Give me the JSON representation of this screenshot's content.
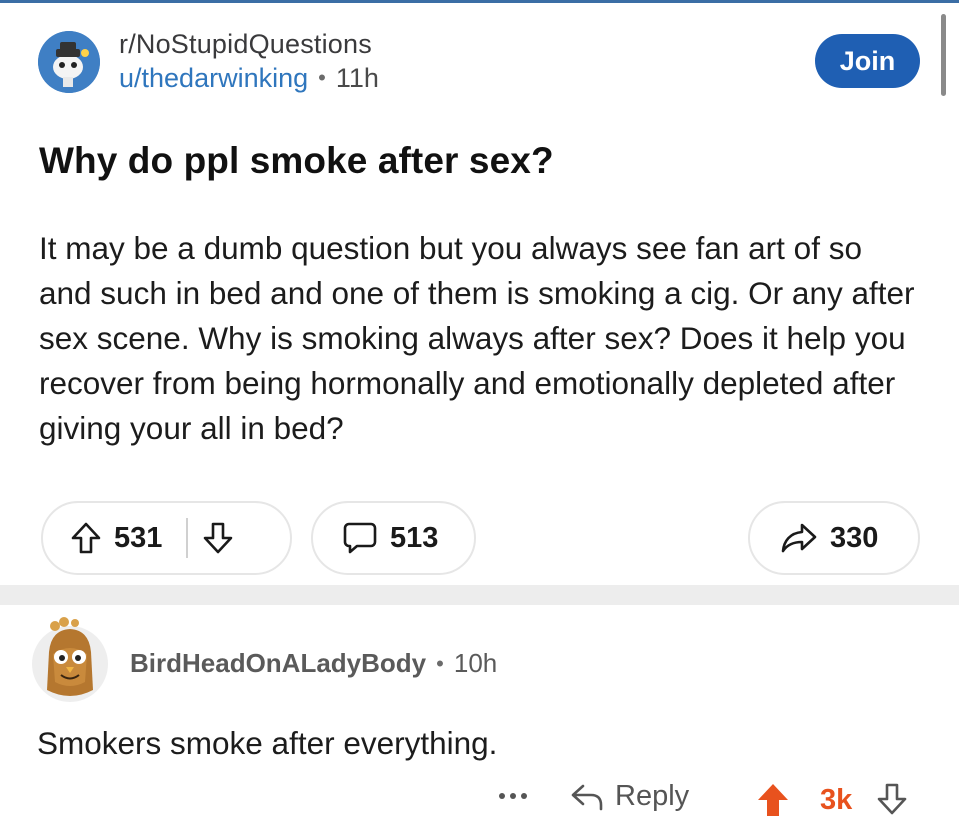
{
  "post": {
    "subreddit": "r/NoStupidQuestions",
    "author": "u/thedarwinking",
    "separator": "•",
    "age": "11h",
    "join_label": "Join",
    "title": "Why do ppl smoke after sex?",
    "body": "It may be a dumb question but you always see fan art of so and such in bed and one of them is smoking a cig. Or any after sex scene. Why is smoking always after sex? Does it help you recover from being  hormonally and emotionally depleted after giving your all in bed?",
    "upvotes": "531",
    "comments": "513",
    "shares": "330"
  },
  "comment": {
    "author": "BirdHeadOnALadyBody",
    "separator": "•",
    "age": "10h",
    "text": "Smokers smoke after everything.",
    "more_label": "•••",
    "reply_label": "Reply",
    "score": "3k"
  },
  "icons": {
    "subreddit_avatar": "snoo-avatar-icon",
    "upvote": "arrow-up-outline-icon",
    "downvote": "arrow-down-outline-icon",
    "comments": "speech-bubble-icon",
    "share": "share-arrow-icon",
    "reply": "reply-arrow-icon",
    "upvote_active": "arrow-up-filled-icon"
  },
  "colors": {
    "accent_blue": "#1f5fb3",
    "username_blue": "#2f76bd",
    "upvote_orange": "#e8521e",
    "divider": "#ededed"
  }
}
